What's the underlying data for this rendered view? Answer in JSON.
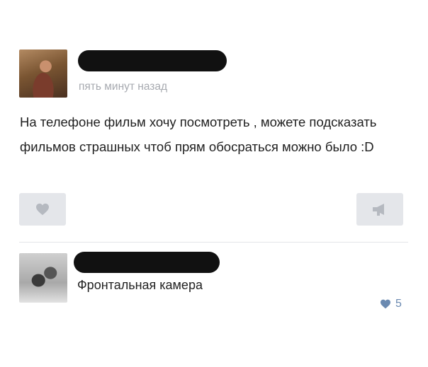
{
  "post": {
    "time": "пять минут назад",
    "text": "На телефоне фильм хочу посмотреть , можете подсказать фильмов страшных чтоб прям обосраться можно было :D",
    "actions": {
      "like_icon": "heart-icon",
      "share_icon": "megaphone-icon"
    }
  },
  "comment": {
    "text": "Фронтальная камера",
    "likes": "5",
    "likes_icon": "heart-icon"
  },
  "colors": {
    "muted_text": "#a7aab0",
    "button_bg": "#e4e6ea",
    "icon_gray": "#b5b9c0",
    "like_blue": "#6b8ab1",
    "redaction": "#111111"
  }
}
